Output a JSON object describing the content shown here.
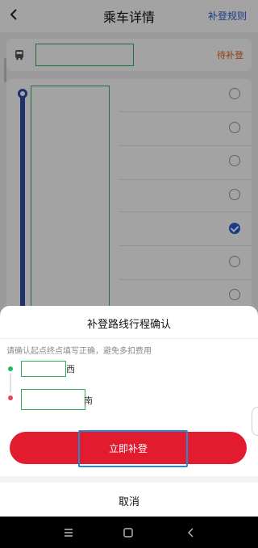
{
  "header": {
    "title": "乘车详情",
    "rules_link": "补登规则",
    "back_icon": "chevron-left-icon"
  },
  "trip": {
    "status": "待补登"
  },
  "stops": {
    "selected_index": 4,
    "count": 7
  },
  "sheet": {
    "title": "补登路线行程确认",
    "hint": "请确认起点终点填写正确，避免多扣费用",
    "start_suffix": "西",
    "end_suffix": "南",
    "submit_label": "立即补登",
    "cancel_label": "取消"
  },
  "colors": {
    "accent_blue": "#2c5bd6",
    "track_blue": "#2d4fa6",
    "status_orange": "#e0601d",
    "submit_red": "#e31b2f",
    "start_green": "#28b463",
    "end_red": "#e5484d"
  }
}
